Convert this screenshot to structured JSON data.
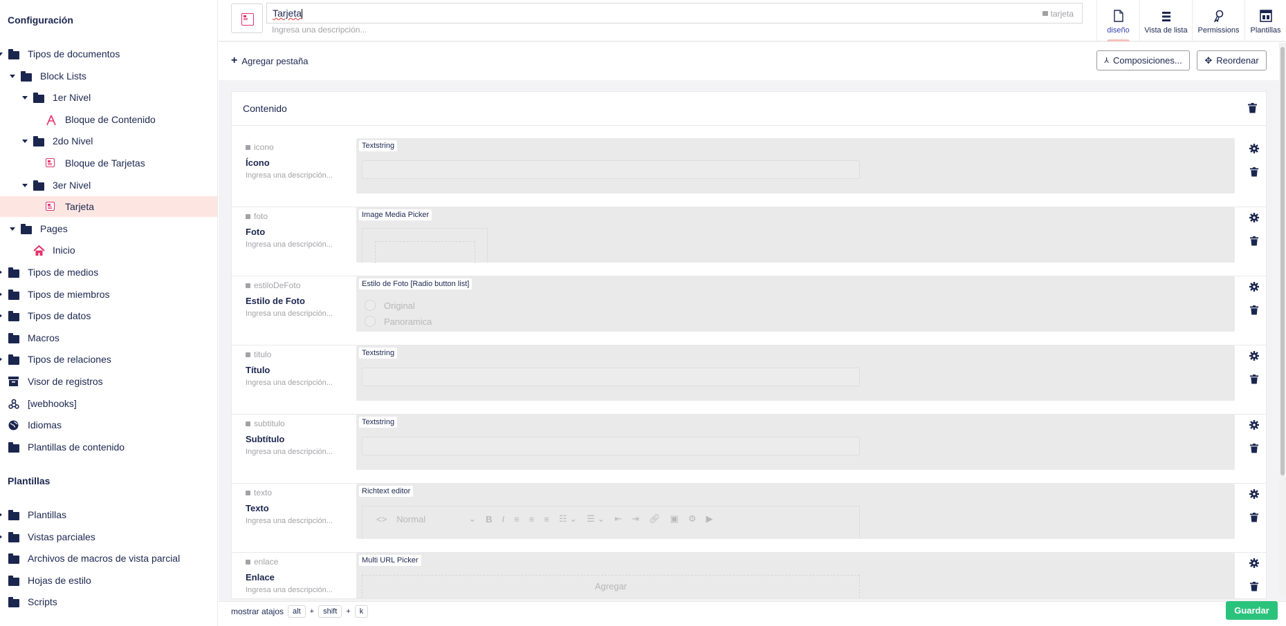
{
  "sidebar": {
    "section_config": "Configuración",
    "section_templates": "Plantillas",
    "tree": [
      {
        "label": "Tipos de documentos",
        "icon": "folder-icon",
        "caret": "open"
      },
      {
        "label": "Block Lists",
        "icon": "folder-icon",
        "caret": "open"
      },
      {
        "label": "1er Nivel",
        "icon": "folder-icon",
        "caret": "open"
      },
      {
        "label": "Bloque de Contenido",
        "icon": "cone-icon",
        "caret": "none"
      },
      {
        "label": "2do Nivel",
        "icon": "folder-icon",
        "caret": "open"
      },
      {
        "label": "Bloque de Tarjetas",
        "icon": "card-icon",
        "caret": "none"
      },
      {
        "label": "3er Nivel",
        "icon": "folder-icon",
        "caret": "open"
      },
      {
        "label": "Tarjeta",
        "icon": "card-icon",
        "caret": "none",
        "active": true
      },
      {
        "label": "Pages",
        "icon": "folder-icon",
        "caret": "open"
      },
      {
        "label": "Inicio",
        "icon": "home-icon",
        "caret": "none"
      },
      {
        "label": "Tipos de medios",
        "icon": "folder-icon",
        "caret": "closed"
      },
      {
        "label": "Tipos de miembros",
        "icon": "folder-icon",
        "caret": "closed"
      },
      {
        "label": "Tipos de datos",
        "icon": "folder-icon",
        "caret": "closed"
      },
      {
        "label": "Macros",
        "icon": "folder-icon",
        "caret": "none"
      },
      {
        "label": "Tipos de relaciones",
        "icon": "folder-icon",
        "caret": "closed"
      },
      {
        "label": "Visor de registros",
        "icon": "box-icon",
        "caret": "none"
      },
      {
        "label": "[webhooks]",
        "icon": "webhook-icon",
        "caret": "none"
      },
      {
        "label": "Idiomas",
        "icon": "globe-icon",
        "caret": "none"
      },
      {
        "label": "Plantillas de contenido",
        "icon": "folder-icon",
        "caret": "none"
      }
    ],
    "tree2": [
      {
        "label": "Plantillas",
        "icon": "folder-icon",
        "caret": "closed"
      },
      {
        "label": "Vistas parciales",
        "icon": "folder-icon",
        "caret": "closed"
      },
      {
        "label": "Archivos de macros de vista parcial",
        "icon": "folder-icon",
        "caret": "none"
      },
      {
        "label": "Hojas de estilo",
        "icon": "folder-icon",
        "caret": "none"
      },
      {
        "label": "Scripts",
        "icon": "folder-icon",
        "caret": "none"
      }
    ]
  },
  "header": {
    "name_value": "Tarjeta",
    "alias": "tarjeta",
    "desc_placeholder": "Ingresa una descripción...",
    "apps": [
      {
        "label": "diseño",
        "icon": "document-icon",
        "active": true
      },
      {
        "label": "Vista de lista",
        "icon": "list-icon"
      },
      {
        "label": "Permissions",
        "icon": "permissions-icon"
      },
      {
        "label": "Plantillas",
        "icon": "templates-icon"
      }
    ]
  },
  "toolbar": {
    "add_tab": "Agregar pestaña",
    "compositions": "Composiciones...",
    "reorder": "Reordenar"
  },
  "group": {
    "title": "Contenido",
    "properties": [
      {
        "alias": "icono",
        "name": "Ícono",
        "desc": "Ingresa una descripción...",
        "editor": "Textstring",
        "kind": "text"
      },
      {
        "alias": "foto",
        "name": "Foto",
        "desc": "Ingresa una descripción...",
        "editor": "Image Media Picker",
        "kind": "media"
      },
      {
        "alias": "estiloDeFoto",
        "name": "Estilo de Foto",
        "desc": "Ingresa una descripción...",
        "editor": "Estilo de Foto [Radio button list]",
        "kind": "radio",
        "options": [
          "Original",
          "Panoramica"
        ]
      },
      {
        "alias": "titulo",
        "name": "Título",
        "desc": "Ingresa una descripción...",
        "editor": "Textstring",
        "kind": "text"
      },
      {
        "alias": "subtitulo",
        "name": "Subtítulo",
        "desc": "Ingresa una descripción...",
        "editor": "Textstring",
        "kind": "text"
      },
      {
        "alias": "texto",
        "name": "Texto",
        "desc": "Ingresa una descripción...",
        "editor": "Richtext editor",
        "kind": "rte",
        "rte_format": "Normal"
      },
      {
        "alias": "enlace",
        "name": "Enlace",
        "desc": "Ingresa una descripción...",
        "editor": "Multi URL Picker",
        "kind": "url",
        "add_label": "Agregar"
      }
    ]
  },
  "footer": {
    "shortcuts_label": "mostrar atajos",
    "keys": [
      "alt",
      "+",
      "shift",
      "+",
      "k"
    ],
    "save": "Guardar"
  },
  "colors": {
    "accent": "#1b264f",
    "active_bg": "#fde6e2",
    "pink": "#e0336b",
    "save_green": "#2bc37c"
  }
}
